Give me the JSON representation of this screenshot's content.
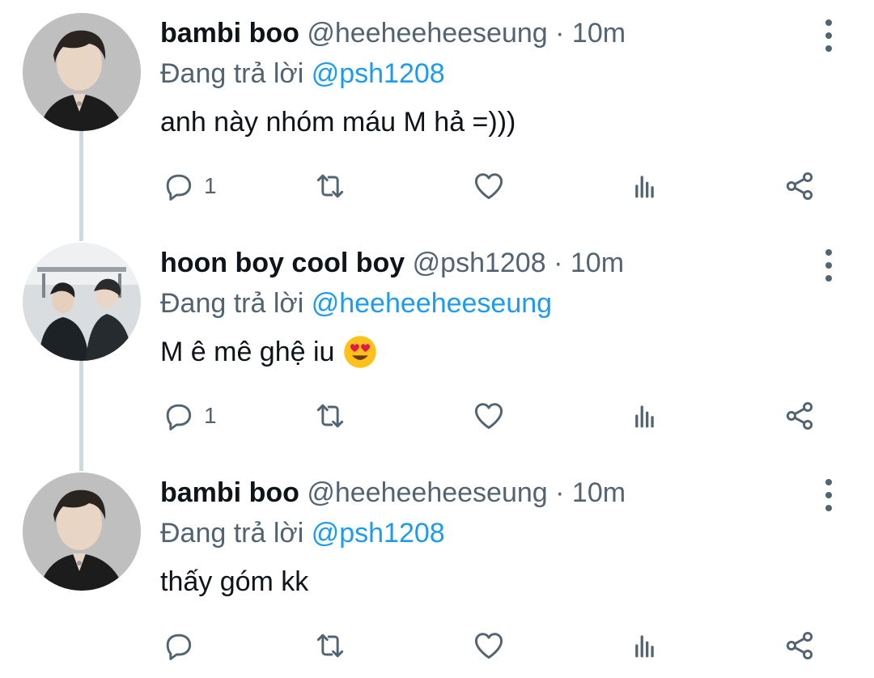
{
  "tweets": [
    {
      "display_name": "bambi boo",
      "handle": "@heeheeheeseung",
      "separator": "·",
      "time": "10m",
      "reply_prefix": "Đang trả lời",
      "reply_to": "@psh1208",
      "text": "anh này nhóm máu M hả =)))",
      "reply_count": "1",
      "avatar": "portrait-boy-gray"
    },
    {
      "display_name": "hoon boy cool boy",
      "handle": "@psh1208",
      "separator": "·",
      "time": "10m",
      "reply_prefix": "Đang trả lời",
      "reply_to": "@heeheeheeseung",
      "text": "M ê mê ghệ iu",
      "emoji": "😍",
      "reply_count": "1",
      "avatar": "two-boys-photo"
    },
    {
      "display_name": "bambi boo",
      "handle": "@heeheeheeseung",
      "separator": "·",
      "time": "10m",
      "reply_prefix": "Đang trả lời",
      "reply_to": "@psh1208",
      "text": "thấy góm kk",
      "reply_count": "",
      "avatar": "portrait-boy-gray"
    }
  ],
  "icons": {
    "reply": "speech-bubble-icon",
    "retweet": "retweet-icon",
    "like": "heart-icon",
    "views": "bar-chart-icon",
    "share": "share-icon",
    "more": "vertical-dots-icon"
  },
  "colors": {
    "link": "#1d9bf0",
    "secondary_text": "#536471",
    "thread_line": "#cfd9de"
  }
}
